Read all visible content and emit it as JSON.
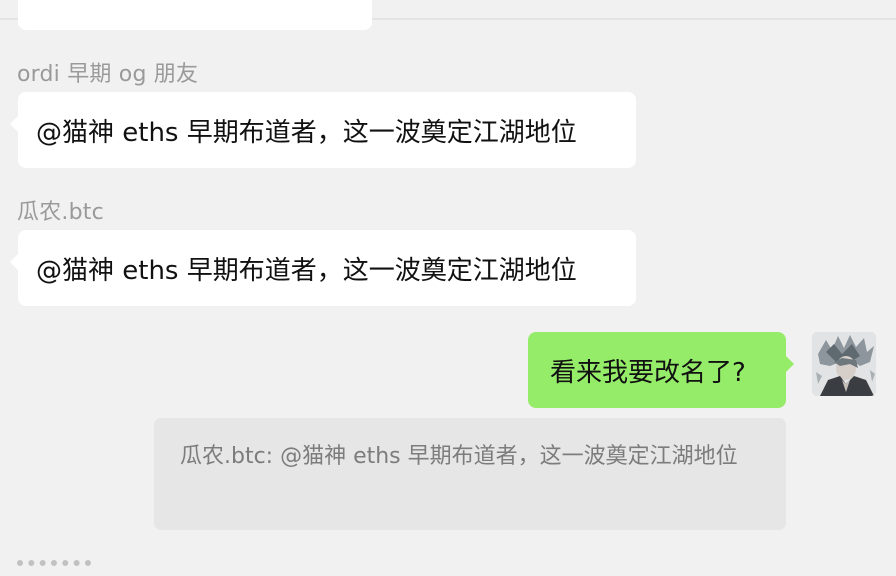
{
  "messages": [
    {
      "sender": "ordi 早期 og 朋友",
      "text": "@猫神 eths 早期布道者，这一波奠定江湖地位"
    },
    {
      "sender": "瓜农.btc",
      "text": "@猫神 eths 早期布道者，这一波奠定江湖地位"
    }
  ],
  "outgoing": {
    "text": "看来我要改名了?",
    "bubble_color": "#95ec69"
  },
  "quote": {
    "text": "瓜农.btc: @猫神 eths 早期布道者，这一波奠定江湖地位"
  },
  "colors": {
    "background": "#f1f1f1",
    "incoming_bubble": "#ffffff",
    "sender_name": "#9a9a9a",
    "quote_background": "#e6e6e6"
  }
}
